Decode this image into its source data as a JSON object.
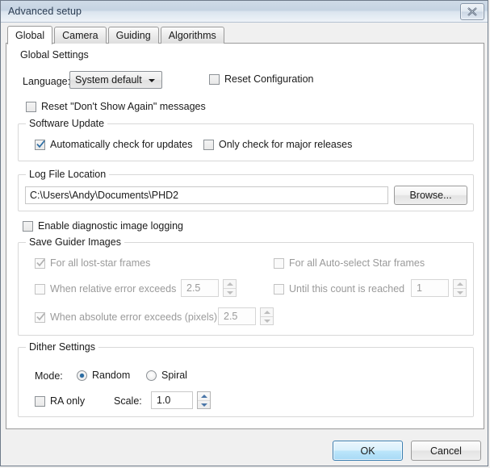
{
  "window": {
    "title": "Advanced setup",
    "close_icon": "close-icon"
  },
  "tabs": [
    {
      "label": "Global",
      "active": true
    },
    {
      "label": "Camera",
      "active": false
    },
    {
      "label": "Guiding",
      "active": false
    },
    {
      "label": "Algorithms",
      "active": false
    }
  ],
  "global_settings": {
    "legend": "Global Settings",
    "language_label": "Language:",
    "language_value": "System default",
    "language_options": [
      "System default"
    ],
    "reset_configuration": {
      "label": "Reset Configuration",
      "checked": false,
      "enabled": true
    },
    "reset_dont_show_again": {
      "label": "Reset \"Don't Show Again\" messages",
      "checked": false,
      "enabled": true
    }
  },
  "software_update": {
    "legend": "Software Update",
    "auto_check": {
      "label": "Automatically check for updates",
      "checked": true,
      "enabled": true
    },
    "major_only": {
      "label": "Only check for major releases",
      "checked": false,
      "enabled": true
    }
  },
  "log_file_location": {
    "legend": "Log File Location",
    "path": "C:\\Users\\Andy\\Documents\\PHD2",
    "browse_label": "Browse..."
  },
  "diagnostic_logging": {
    "label": "Enable diagnostic image logging",
    "checked": false,
    "enabled": true
  },
  "save_guider_images": {
    "legend": "Save Guider Images",
    "lost_star": {
      "label": "For all lost-star frames",
      "checked": true,
      "enabled": false
    },
    "auto_select": {
      "label": "For all Auto-select Star frames",
      "checked": false,
      "enabled": false
    },
    "relative_error": {
      "label": "When relative error exceeds",
      "checked": false,
      "enabled": false,
      "value": "2.5"
    },
    "until_count": {
      "label": "Until this count is reached",
      "checked": false,
      "enabled": false,
      "value": "1"
    },
    "absolute_error": {
      "label": "When absolute error exceeds (pixels)",
      "checked": true,
      "enabled": false,
      "value": "2.5"
    }
  },
  "dither_settings": {
    "legend": "Dither Settings",
    "mode_label": "Mode:",
    "mode_random": {
      "label": "Random",
      "selected": true
    },
    "mode_spiral": {
      "label": "Spiral",
      "selected": false
    },
    "ra_only": {
      "label": "RA only",
      "checked": false,
      "enabled": true
    },
    "scale_label": "Scale:",
    "scale_value": "1.0"
  },
  "footer": {
    "ok_label": "OK",
    "cancel_label": "Cancel"
  },
  "colors": {
    "titlebar_top": "#cfdbe7",
    "titlebar_bottom": "#eef3f8",
    "dialog_bg": "#f0f0f0",
    "page_bg": "#ffffff",
    "accent_blue": "#2b6ca3",
    "default_button_border": "#3c7fb1",
    "disabled_text": "#9a9a9a"
  }
}
